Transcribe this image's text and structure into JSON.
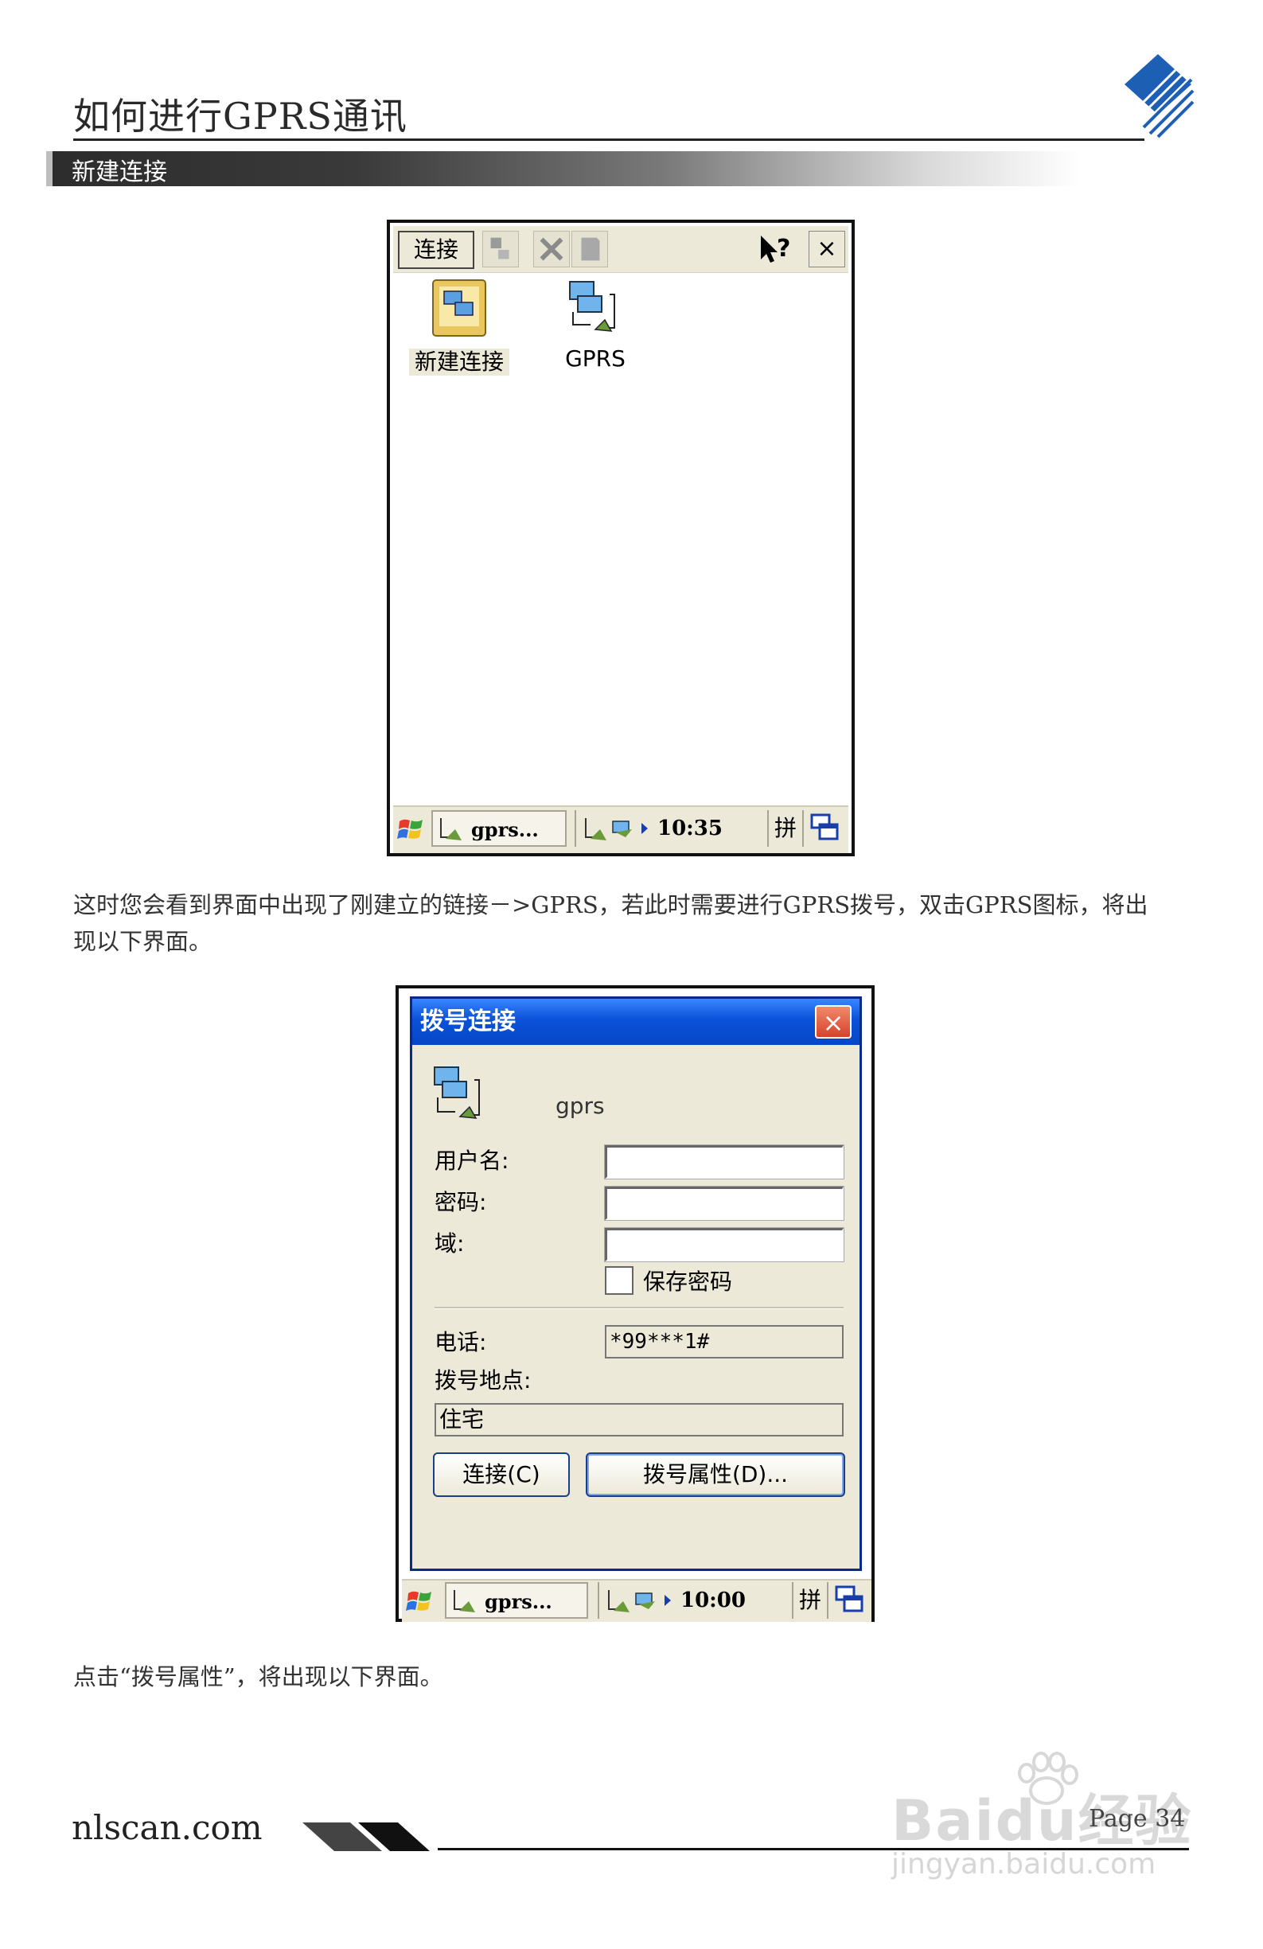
{
  "header": {
    "title": "如何进行GPRS通讯",
    "section": "新建连接"
  },
  "screenshot1": {
    "menu_label": "连接",
    "help_label": "?",
    "close_label": "×",
    "icons": [
      {
        "label": "新建连接",
        "icon": "new-connection-icon"
      },
      {
        "label": "GPRS",
        "icon": "network-connection-icon"
      }
    ],
    "taskbar": {
      "task": "gprs...",
      "time": "10:35",
      "ime": "拼"
    }
  },
  "paragraph1": "这时您会看到界面中出现了刚建立的链接－>GPRS，若此时需要进行GPRS拨号，双击GPRS图标，将出现以下界面。",
  "screenshot2": {
    "title": "拨号连接",
    "close_label": "×",
    "connection_name": "gprs",
    "username_label": "用户名:",
    "username_value": "",
    "password_label": "密码:",
    "password_value": "",
    "domain_label": "域:",
    "domain_value": "",
    "save_password_label": "保存密码",
    "save_password_checked": false,
    "phone_label": "电话:",
    "phone_value": "*99***1#",
    "dial_from_label": "拨号地点:",
    "dial_from_value": "住宅",
    "connect_button": "连接(C)",
    "dial_properties_button": "拨号属性(D)...",
    "taskbar": {
      "task": "gprs...",
      "time": "10:00",
      "ime": "拼"
    }
  },
  "paragraph2": "点击“拨号属性”，将出现以下界面。",
  "footer": {
    "url": "nlscan.com",
    "page": "Page 34"
  },
  "watermark": {
    "main": "Baidu经验",
    "sub": "jingyan.baidu.com"
  },
  "colors": {
    "title_bar_blue": "#0a52d9",
    "dialog_bg": "#ece9d8",
    "logo_blue": "#1d5fb5"
  }
}
